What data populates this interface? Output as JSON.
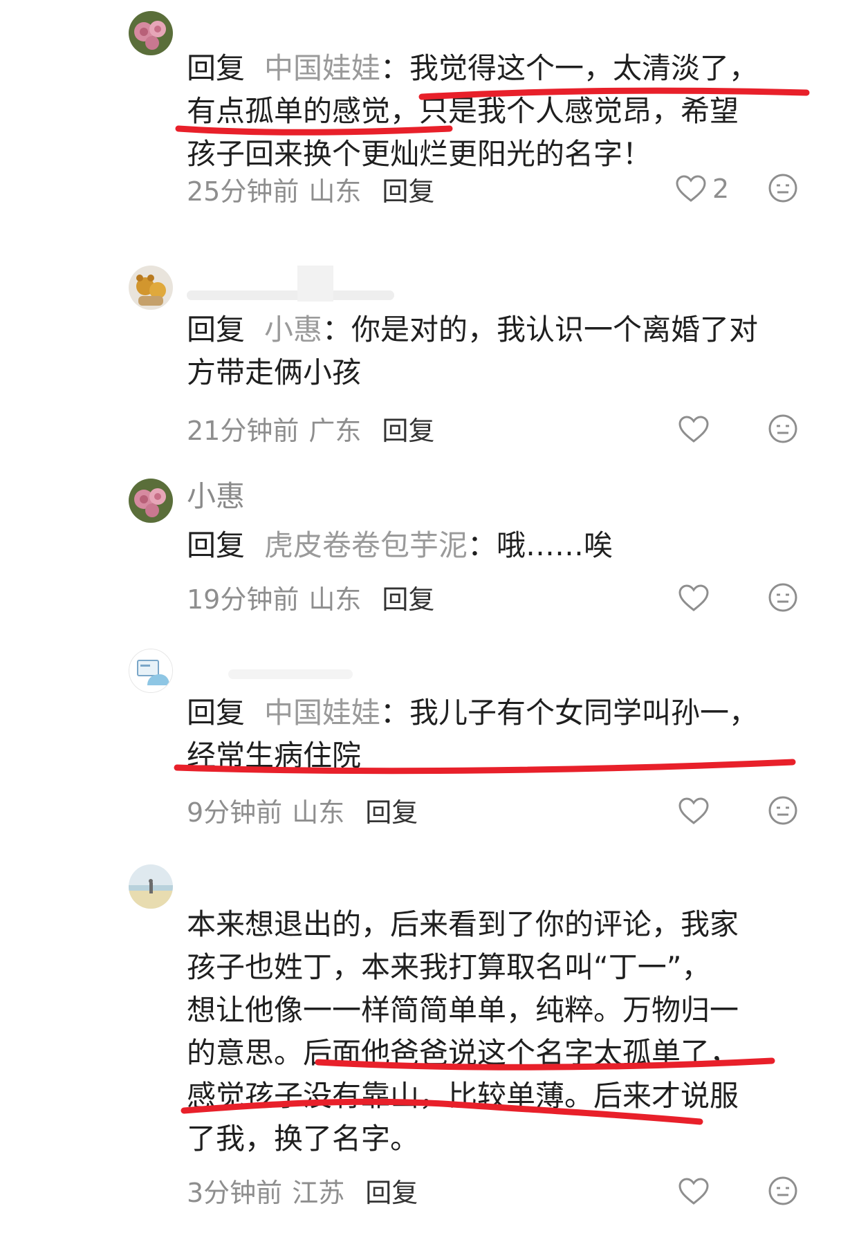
{
  "comments": [
    {
      "reply_prefix": "回复",
      "reply_target": "中国娃娃",
      "colon": "：",
      "lines": [
        "我觉得这个一，太清淡了，",
        "有点孤单的感觉，只是我个人感觉昂，希望",
        "孩子回来换个更灿烂更阳光的名字！"
      ],
      "time": "25分钟前",
      "location": "山东",
      "reply_label": "回复",
      "likes": "2"
    },
    {
      "reply_prefix": "回复",
      "reply_target": "小惠",
      "colon": "：",
      "lines": [
        "你是对的，我认识一个离婚了对",
        "方带走俩小孩"
      ],
      "time": "21分钟前",
      "location": "广东",
      "reply_label": "回复"
    },
    {
      "username": "小惠",
      "reply_prefix": "回复",
      "reply_target": "虎皮卷卷包芋泥",
      "colon": "：",
      "lines": [
        "哦……唉"
      ],
      "time": "19分钟前",
      "location": "山东",
      "reply_label": "回复"
    },
    {
      "reply_prefix": "回复",
      "reply_target": "中国娃娃",
      "colon": "：",
      "lines": [
        "我儿子有个女同学叫孙一，",
        "经常生病住院"
      ],
      "time": "9分钟前",
      "location": "山东",
      "reply_label": "回复"
    },
    {
      "lines": [
        "本来想退出的，后来看到了你的评论，我家",
        "孩子也姓丁，本来我打算取名叫“丁一”，",
        "想让他像一一样简简单单，纯粹。万物归一",
        "的意思。后面他爸爸说这个名字太孤单了，",
        "感觉孩子没有靠山，比较单薄。后来才说服",
        "了我，换了名字。"
      ],
      "time": "3分钟前",
      "location": "江苏",
      "reply_label": "回复"
    }
  ],
  "colors": {
    "highlight_underline": "#e8202a",
    "muted_text": "#8e8e8e",
    "body_text": "#1f1f1f"
  },
  "icons": [
    "heart-icon",
    "emoji-reaction-icon"
  ]
}
